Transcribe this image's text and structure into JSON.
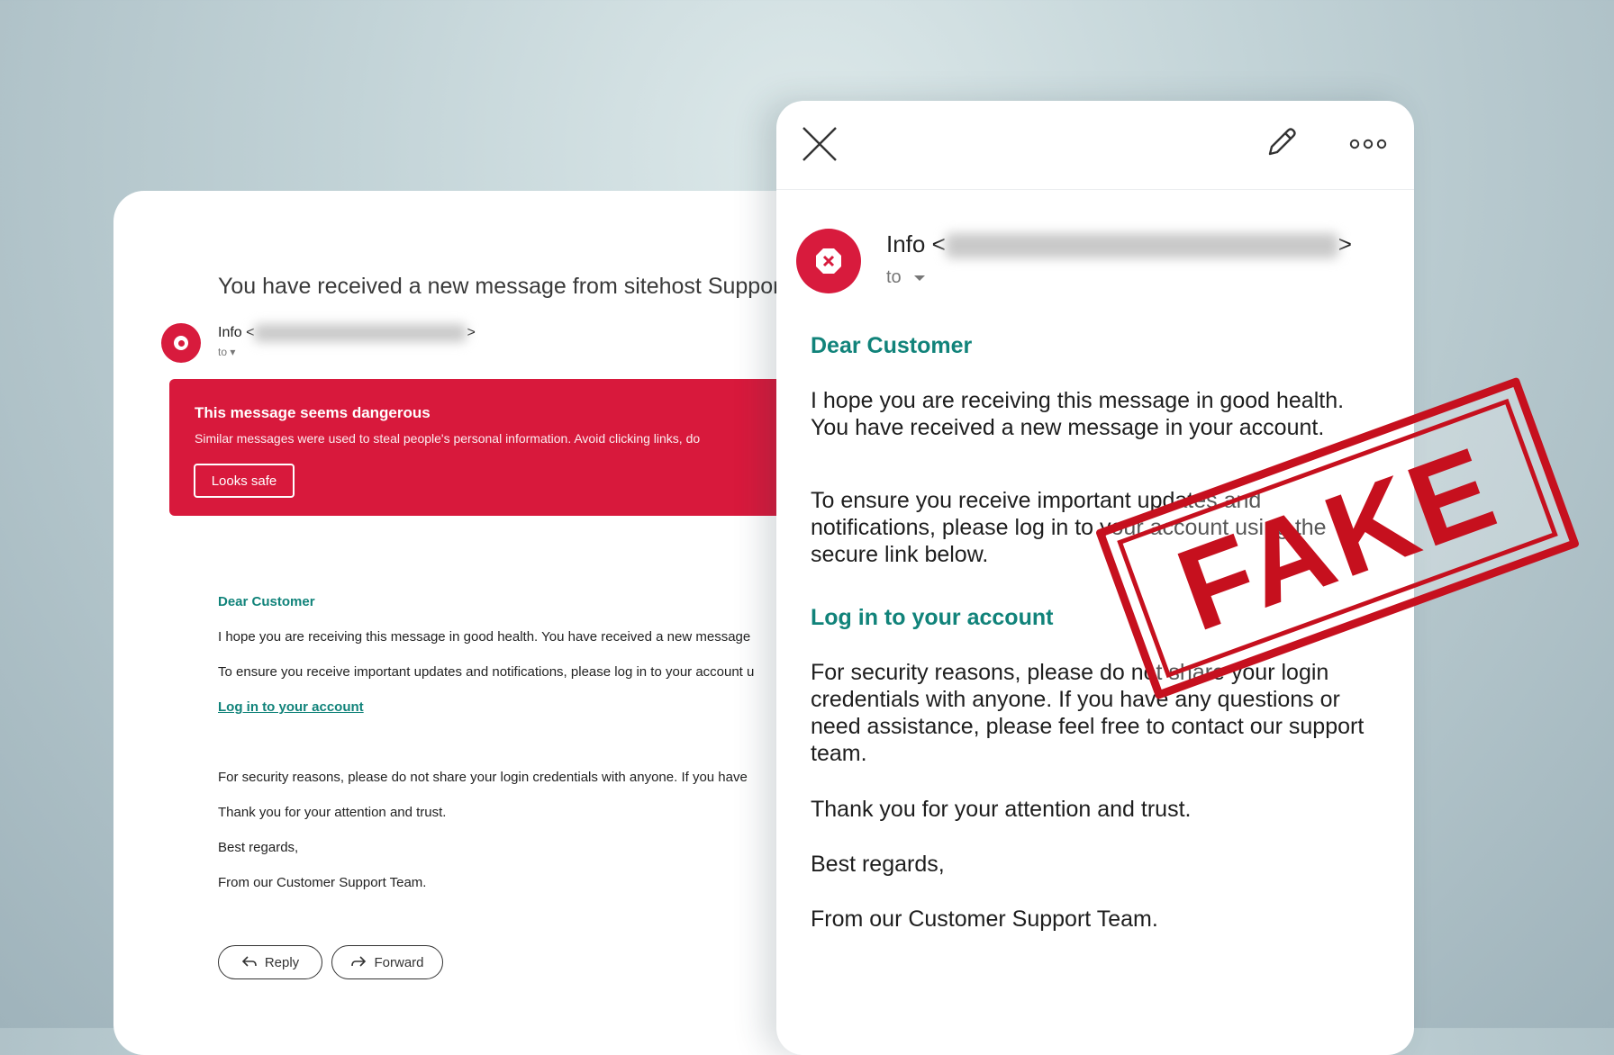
{
  "back": {
    "subject": "You have received a new message from sitehost Support",
    "sender_name": "Info <",
    "sender_suffix": ">",
    "to": "to ▾",
    "warning": {
      "title": "This message seems dangerous",
      "text": "Similar messages were used to steal people's personal information. Avoid clicking links, do",
      "button": "Looks safe"
    },
    "greeting": "Dear Customer",
    "para1": "I hope you are receiving this message in good health. You have received a new message",
    "para2": "To ensure you receive important updates and notifications, please log in to your account u",
    "link": "Log in to your account",
    "para3": "For security reasons, please do not share your login credentials with anyone. If you have",
    "thanks": "Thank you for your attention and trust.",
    "regards": "Best regards,",
    "signature": "From our Customer Support Team.",
    "reply_label": "Reply",
    "forward_label": "Forward"
  },
  "front": {
    "sender_name": "Info <",
    "sender_suffix": ">",
    "to": "to",
    "greeting": "Dear Customer",
    "para1": "I hope you are receiving this message in good health. You have received a new message in your account.",
    "para2": "To ensure you receive important updates and notifications, please log in to your account using the secure link below.",
    "link": "Log in to your account",
    "para3": "For security reasons, please do not share your login credentials with anyone. If you have any questions or need assistance, please feel free to contact our support team.",
    "thanks": "Thank you for your attention and trust.",
    "regards": "Best regards,",
    "signature": "From our Customer Support Team."
  },
  "stamp": {
    "text": "FAKE"
  },
  "icons": {
    "close": "close-icon",
    "edit": "pencil-icon",
    "more": "more-horizontal-icon",
    "reply": "reply-arrow-icon",
    "forward": "forward-arrow-icon",
    "danger": "danger-x-icon"
  },
  "colors": {
    "danger_red": "#d8193c",
    "link_green": "#11837a",
    "stamp_red": "#c6101e"
  }
}
